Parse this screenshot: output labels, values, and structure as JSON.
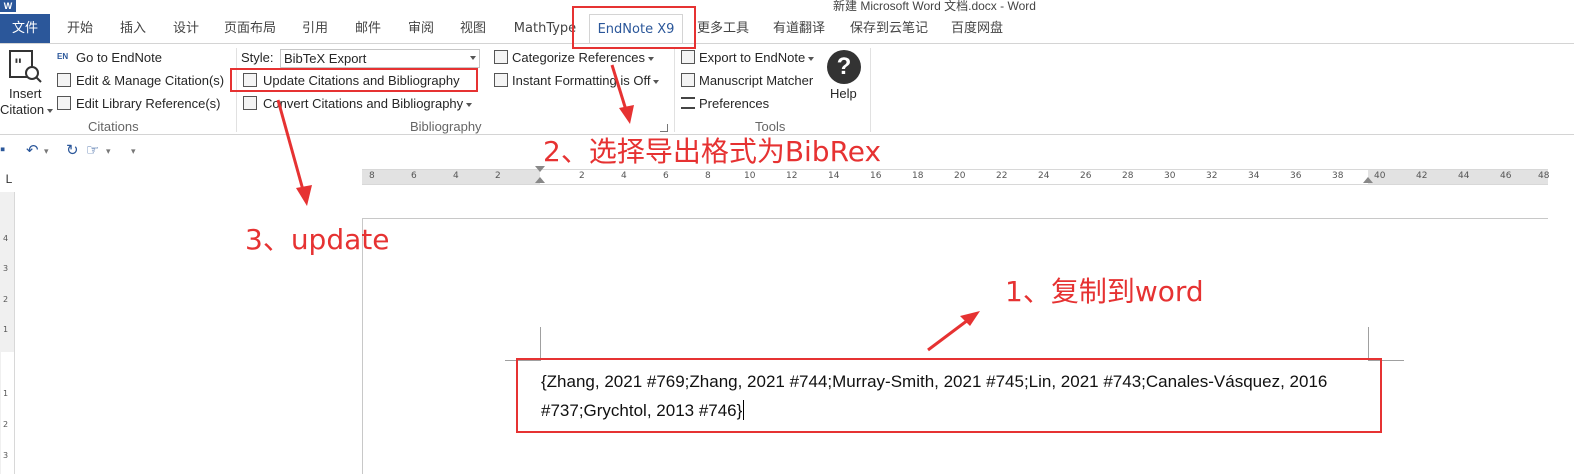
{
  "window": {
    "app_logo": "W",
    "title": "新建 Microsoft Word 文档.docx - Word"
  },
  "tabs": [
    {
      "label": "文件"
    },
    {
      "label": "开始"
    },
    {
      "label": "插入"
    },
    {
      "label": "设计"
    },
    {
      "label": "页面布局"
    },
    {
      "label": "引用"
    },
    {
      "label": "邮件"
    },
    {
      "label": "审阅"
    },
    {
      "label": "视图"
    },
    {
      "label": "MathType"
    },
    {
      "label": "EndNote X9"
    },
    {
      "label": "更多工具"
    },
    {
      "label": "有道翻译"
    },
    {
      "label": "保存到云笔记"
    },
    {
      "label": "百度网盘"
    }
  ],
  "ribbon": {
    "citations": {
      "insert_line1": "Insert",
      "insert_line2": "Citation",
      "go_to_endnote": "Go to EndNote",
      "edit_manage": "Edit & Manage Citation(s)",
      "edit_library": "Edit Library Reference(s)",
      "group_label": "Citations",
      "en_badge": "EN"
    },
    "bibliography": {
      "style_label": "Style:",
      "style_value": "BibTeX Export",
      "update": "Update Citations and Bibliography",
      "convert": "Convert Citations and Bibliography",
      "categorize": "Categorize References",
      "instant_formatting": "Instant Formatting is Off",
      "group_label": "Bibliography"
    },
    "tools": {
      "export": "Export to EndNote",
      "manuscript": "Manuscript Matcher",
      "preferences": "Preferences",
      "group_label": "Tools",
      "help_label": "Help",
      "help_glyph": "?"
    }
  },
  "ruler": {
    "corner": "L",
    "left_numbers": [
      "8",
      "6",
      "4",
      "2"
    ],
    "right_numbers": [
      "2",
      "4",
      "6",
      "8",
      "10",
      "12",
      "14",
      "16",
      "18",
      "20",
      "22",
      "24",
      "26",
      "28",
      "30",
      "32",
      "34",
      "36",
      "38",
      "40",
      "42",
      "44",
      "46",
      "48"
    ],
    "vertical_numbers": [
      "4",
      "3",
      "2",
      "1",
      "1",
      "2",
      "3"
    ]
  },
  "document": {
    "text": "{Zhang, 2021 #769;Zhang, 2021 #744;Murray-Smith, 2021 #745;Lin, 2021 #743;Canales-Vásquez, 2016 #737;Grychtol, 2013 #746}"
  },
  "annotations": {
    "step1": "1、复制到word",
    "step2": "2、选择导出格式为BibRex",
    "step3": "3、update",
    "color": "#e63232"
  },
  "colors": {
    "word_blue": "#2b579a",
    "annotation_red": "#e63232"
  }
}
